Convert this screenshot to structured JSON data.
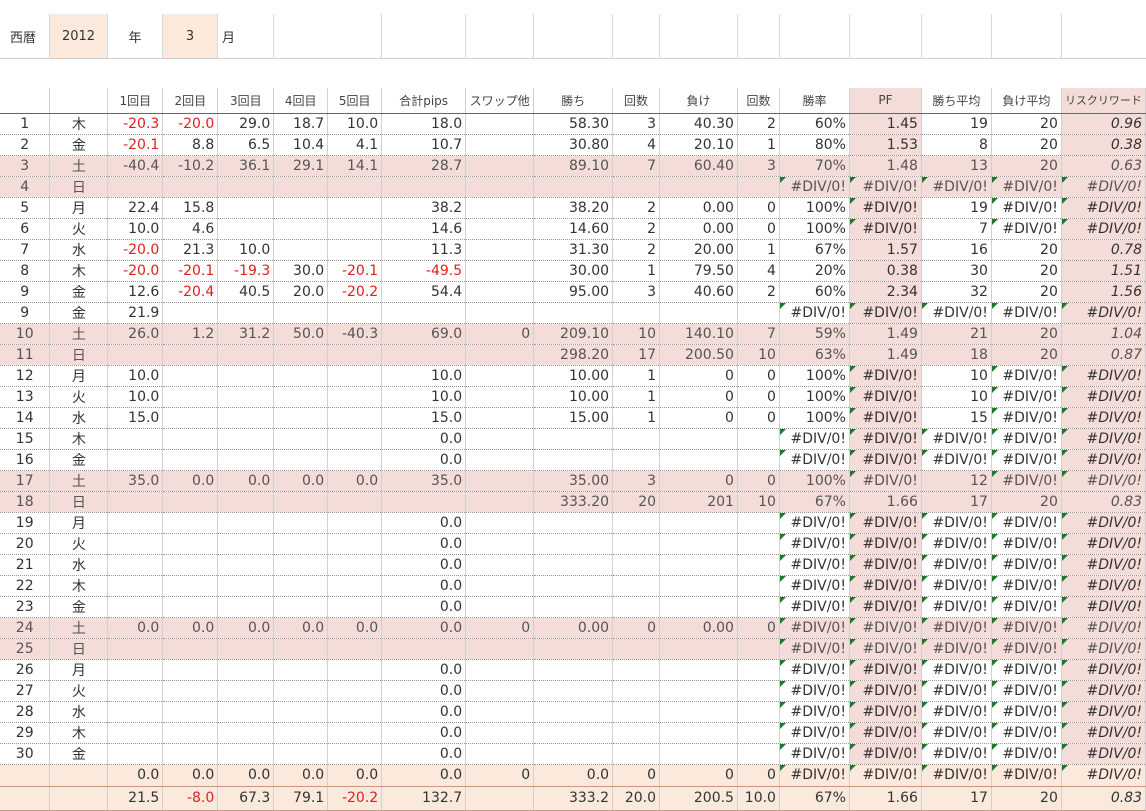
{
  "header": {
    "era_label": "西暦",
    "year": "2012",
    "year_unit": "年",
    "month": "3",
    "month_unit": "月"
  },
  "columns": [
    "",
    "",
    "1回目",
    "2回目",
    "3回目",
    "4回目",
    "5回目",
    "合計pips",
    "スワップ他",
    "勝ち",
    "回数",
    "負け",
    "回数",
    "勝率",
    "PF",
    "勝ち平均",
    "負け平均",
    "リスクリワード"
  ],
  "rows": [
    {
      "d": "1",
      "w": "木",
      "t": [
        "-20.3",
        "-20.0",
        "29.0",
        "18.7",
        "10.0"
      ],
      "sum": "18.0",
      "swap": "",
      "win": "58.30",
      "wn": "3",
      "loss": "40.30",
      "ln": "2",
      "rate": "60%",
      "pf": "1.45",
      "wa": "19",
      "la": "20",
      "rr": "0.96"
    },
    {
      "d": "2",
      "w": "金",
      "t": [
        "-20.1",
        "8.8",
        "6.5",
        "10.4",
        "4.1"
      ],
      "sum": "10.7",
      "swap": "",
      "win": "30.80",
      "wn": "4",
      "loss": "20.10",
      "ln": "1",
      "rate": "80%",
      "pf": "1.53",
      "wa": "8",
      "la": "20",
      "rr": "0.38"
    },
    {
      "d": "3",
      "w": "土",
      "t": [
        "-40.4",
        "-10.2",
        "36.1",
        "29.1",
        "14.1"
      ],
      "sum": "28.7",
      "swap": "",
      "win": "89.10",
      "wn": "7",
      "loss": "60.40",
      "ln": "3",
      "rate": "70%",
      "pf": "1.48",
      "wa": "13",
      "la": "20",
      "rr": "0.63",
      "weekend": true
    },
    {
      "d": "4",
      "w": "日",
      "t": [
        "",
        "",
        "",
        "",
        ""
      ],
      "sum": "",
      "swap": "",
      "win": "",
      "wn": "",
      "loss": "",
      "ln": "",
      "rate": "#DIV/0!",
      "pf": "#DIV/0!",
      "wa": "#DIV/0!",
      "la": "#DIV/0!",
      "rr": "#DIV/0!",
      "weekend": true
    },
    {
      "d": "5",
      "w": "月",
      "t": [
        "22.4",
        "15.8",
        "",
        "",
        ""
      ],
      "sum": "38.2",
      "swap": "",
      "win": "38.20",
      "wn": "2",
      "loss": "0.00",
      "ln": "0",
      "rate": "100%",
      "pf": "#DIV/0!",
      "wa": "19",
      "la": "#DIV/0!",
      "rr": "#DIV/0!"
    },
    {
      "d": "6",
      "w": "火",
      "t": [
        "10.0",
        "4.6",
        "",
        "",
        ""
      ],
      "sum": "14.6",
      "swap": "",
      "win": "14.60",
      "wn": "2",
      "loss": "0.00",
      "ln": "0",
      "rate": "100%",
      "pf": "#DIV/0!",
      "wa": "7",
      "la": "#DIV/0!",
      "rr": "#DIV/0!"
    },
    {
      "d": "7",
      "w": "水",
      "t": [
        "-20.0",
        "21.3",
        "10.0",
        "",
        ""
      ],
      "sum": "11.3",
      "swap": "",
      "win": "31.30",
      "wn": "2",
      "loss": "20.00",
      "ln": "1",
      "rate": "67%",
      "pf": "1.57",
      "wa": "16",
      "la": "20",
      "rr": "0.78"
    },
    {
      "d": "8",
      "w": "木",
      "t": [
        "-20.0",
        "-20.1",
        "-19.3",
        "30.0",
        "-20.1"
      ],
      "sum": "-49.5",
      "swap": "",
      "win": "30.00",
      "wn": "1",
      "loss": "79.50",
      "ln": "4",
      "rate": "20%",
      "pf": "0.38",
      "wa": "30",
      "la": "20",
      "rr": "1.51"
    },
    {
      "d": "9",
      "w": "金",
      "t": [
        "12.6",
        "-20.4",
        "40.5",
        "20.0",
        "-20.2"
      ],
      "sum": "54.4",
      "swap": "",
      "win": "95.00",
      "wn": "3",
      "loss": "40.60",
      "ln": "2",
      "rate": "60%",
      "pf": "2.34",
      "wa": "32",
      "la": "20",
      "rr": "1.56"
    },
    {
      "d": "9",
      "w": "金",
      "t": [
        "21.9",
        "",
        "",
        "",
        ""
      ],
      "sum": "",
      "swap": "",
      "win": "",
      "wn": "",
      "loss": "",
      "ln": "",
      "rate": "#DIV/0!",
      "pf": "#DIV/0!",
      "wa": "#DIV/0!",
      "la": "#DIV/0!",
      "rr": "#DIV/0!"
    },
    {
      "d": "10",
      "w": "土",
      "t": [
        "26.0",
        "1.2",
        "31.2",
        "50.0",
        "-40.3"
      ],
      "sum": "69.0",
      "swap": "0",
      "win": "209.10",
      "wn": "10",
      "loss": "140.10",
      "ln": "7",
      "rate": "59%",
      "pf": "1.49",
      "wa": "21",
      "la": "20",
      "rr": "1.04",
      "weekend": true
    },
    {
      "d": "11",
      "w": "日",
      "t": [
        "",
        "",
        "",
        "",
        ""
      ],
      "sum": "",
      "swap": "",
      "win": "298.20",
      "wn": "17",
      "loss": "200.50",
      "ln": "10",
      "rate": "63%",
      "pf": "1.49",
      "wa": "18",
      "la": "20",
      "rr": "0.87",
      "weekend": true
    },
    {
      "d": "12",
      "w": "月",
      "t": [
        "10.0",
        "",
        "",
        "",
        ""
      ],
      "sum": "10.0",
      "swap": "",
      "win": "10.00",
      "wn": "1",
      "loss": "0",
      "ln": "0",
      "rate": "100%",
      "pf": "#DIV/0!",
      "wa": "10",
      "la": "#DIV/0!",
      "rr": "#DIV/0!"
    },
    {
      "d": "13",
      "w": "火",
      "t": [
        "10.0",
        "",
        "",
        "",
        ""
      ],
      "sum": "10.0",
      "swap": "",
      "win": "10.00",
      "wn": "1",
      "loss": "0",
      "ln": "0",
      "rate": "100%",
      "pf": "#DIV/0!",
      "wa": "10",
      "la": "#DIV/0!",
      "rr": "#DIV/0!"
    },
    {
      "d": "14",
      "w": "水",
      "t": [
        "15.0",
        "",
        "",
        "",
        ""
      ],
      "sum": "15.0",
      "swap": "",
      "win": "15.00",
      "wn": "1",
      "loss": "0",
      "ln": "0",
      "rate": "100%",
      "pf": "#DIV/0!",
      "wa": "15",
      "la": "#DIV/0!",
      "rr": "#DIV/0!"
    },
    {
      "d": "15",
      "w": "木",
      "t": [
        "",
        "",
        "",
        "",
        ""
      ],
      "sum": "0.0",
      "swap": "",
      "win": "",
      "wn": "",
      "loss": "",
      "ln": "",
      "rate": "#DIV/0!",
      "pf": "#DIV/0!",
      "wa": "#DIV/0!",
      "la": "#DIV/0!",
      "rr": "#DIV/0!"
    },
    {
      "d": "16",
      "w": "金",
      "t": [
        "",
        "",
        "",
        "",
        ""
      ],
      "sum": "0.0",
      "swap": "",
      "win": "",
      "wn": "",
      "loss": "",
      "ln": "",
      "rate": "#DIV/0!",
      "pf": "#DIV/0!",
      "wa": "#DIV/0!",
      "la": "#DIV/0!",
      "rr": "#DIV/0!"
    },
    {
      "d": "17",
      "w": "土",
      "t": [
        "35.0",
        "0.0",
        "0.0",
        "0.0",
        "0.0"
      ],
      "sum": "35.0",
      "swap": "",
      "win": "35.00",
      "wn": "3",
      "loss": "0",
      "ln": "0",
      "rate": "100%",
      "pf": "#DIV/0!",
      "wa": "12",
      "la": "#DIV/0!",
      "rr": "#DIV/0!",
      "weekend": true
    },
    {
      "d": "18",
      "w": "日",
      "t": [
        "",
        "",
        "",
        "",
        ""
      ],
      "sum": "",
      "swap": "",
      "win": "333.20",
      "wn": "20",
      "loss": "201",
      "ln": "10",
      "rate": "67%",
      "pf": "1.66",
      "wa": "17",
      "la": "20",
      "rr": "0.83",
      "weekend": true
    },
    {
      "d": "19",
      "w": "月",
      "t": [
        "",
        "",
        "",
        "",
        ""
      ],
      "sum": "0.0",
      "swap": "",
      "win": "",
      "wn": "",
      "loss": "",
      "ln": "",
      "rate": "#DIV/0!",
      "pf": "#DIV/0!",
      "wa": "#DIV/0!",
      "la": "#DIV/0!",
      "rr": "#DIV/0!"
    },
    {
      "d": "20",
      "w": "火",
      "t": [
        "",
        "",
        "",
        "",
        ""
      ],
      "sum": "0.0",
      "swap": "",
      "win": "",
      "wn": "",
      "loss": "",
      "ln": "",
      "rate": "#DIV/0!",
      "pf": "#DIV/0!",
      "wa": "#DIV/0!",
      "la": "#DIV/0!",
      "rr": "#DIV/0!",
      "tall": true
    },
    {
      "d": "21",
      "w": "水",
      "t": [
        "",
        "",
        "",
        "",
        ""
      ],
      "sum": "0.0",
      "swap": "",
      "win": "",
      "wn": "",
      "loss": "",
      "ln": "",
      "rate": "#DIV/0!",
      "pf": "#DIV/0!",
      "wa": "#DIV/0!",
      "la": "#DIV/0!",
      "rr": "#DIV/0!",
      "tall": true
    },
    {
      "d": "22",
      "w": "木",
      "t": [
        "",
        "",
        "",
        "",
        ""
      ],
      "sum": "0.0",
      "swap": "",
      "win": "",
      "wn": "",
      "loss": "",
      "ln": "",
      "rate": "#DIV/0!",
      "pf": "#DIV/0!",
      "wa": "#DIV/0!",
      "la": "#DIV/0!",
      "rr": "#DIV/0!"
    },
    {
      "d": "23",
      "w": "金",
      "t": [
        "",
        "",
        "",
        "",
        ""
      ],
      "sum": "0.0",
      "swap": "",
      "win": "",
      "wn": "",
      "loss": "",
      "ln": "",
      "rate": "#DIV/0!",
      "pf": "#DIV/0!",
      "wa": "#DIV/0!",
      "la": "#DIV/0!",
      "rr": "#DIV/0!"
    },
    {
      "d": "24",
      "w": "土",
      "t": [
        "0.0",
        "0.0",
        "0.0",
        "0.0",
        "0.0"
      ],
      "sum": "0.0",
      "swap": "0",
      "win": "0.00",
      "wn": "0",
      "loss": "0.00",
      "ln": "0",
      "rate": "#DIV/0!",
      "pf": "#DIV/0!",
      "wa": "#DIV/0!",
      "la": "#DIV/0!",
      "rr": "#DIV/0!",
      "weekend": true
    },
    {
      "d": "25",
      "w": "日",
      "t": [
        "",
        "",
        "",
        "",
        ""
      ],
      "sum": "",
      "swap": "",
      "win": "",
      "wn": "",
      "loss": "",
      "ln": "",
      "rate": "#DIV/0!",
      "pf": "#DIV/0!",
      "wa": "#DIV/0!",
      "la": "#DIV/0!",
      "rr": "#DIV/0!",
      "weekend": true
    },
    {
      "d": "26",
      "w": "月",
      "t": [
        "",
        "",
        "",
        "",
        ""
      ],
      "sum": "0.0",
      "swap": "",
      "win": "",
      "wn": "",
      "loss": "",
      "ln": "",
      "rate": "#DIV/0!",
      "pf": "#DIV/0!",
      "wa": "#DIV/0!",
      "la": "#DIV/0!",
      "rr": "#DIV/0!"
    },
    {
      "d": "27",
      "w": "火",
      "t": [
        "",
        "",
        "",
        "",
        ""
      ],
      "sum": "0.0",
      "swap": "",
      "win": "",
      "wn": "",
      "loss": "",
      "ln": "",
      "rate": "#DIV/0!",
      "pf": "#DIV/0!",
      "wa": "#DIV/0!",
      "la": "#DIV/0!",
      "rr": "#DIV/0!"
    },
    {
      "d": "28",
      "w": "水",
      "t": [
        "",
        "",
        "",
        "",
        ""
      ],
      "sum": "0.0",
      "swap": "",
      "win": "",
      "wn": "",
      "loss": "",
      "ln": "",
      "rate": "#DIV/0!",
      "pf": "#DIV/0!",
      "wa": "#DIV/0!",
      "la": "#DIV/0!",
      "rr": "#DIV/0!"
    },
    {
      "d": "29",
      "w": "木",
      "t": [
        "",
        "",
        "",
        "",
        ""
      ],
      "sum": "0.0",
      "swap": "",
      "win": "",
      "wn": "",
      "loss": "",
      "ln": "",
      "rate": "#DIV/0!",
      "pf": "#DIV/0!",
      "wa": "#DIV/0!",
      "la": "#DIV/0!",
      "rr": "#DIV/0!"
    },
    {
      "d": "30",
      "w": "金",
      "t": [
        "",
        "",
        "",
        "",
        ""
      ],
      "sum": "0.0",
      "swap": "",
      "win": "",
      "wn": "",
      "loss": "",
      "ln": "",
      "rate": "#DIV/0!",
      "pf": "#DIV/0!",
      "wa": "#DIV/0!",
      "la": "#DIV/0!",
      "rr": "#DIV/0!"
    }
  ],
  "total_row": {
    "t": [
      "0.0",
      "0.0",
      "0.0",
      "0.0",
      "0.0"
    ],
    "sum": "0.0",
    "swap": "0",
    "win": "0.0",
    "wn": "0",
    "loss": "0",
    "ln": "0",
    "rate": "#DIV/0!",
    "pf": "#DIV/0!",
    "wa": "#DIV/0!",
    "la": "#DIV/0!",
    "rr": "#DIV/0!"
  },
  "grand_row": {
    "t": [
      "21.5",
      "-8.0",
      "67.3",
      "79.1",
      "-20.2"
    ],
    "sum": "132.7",
    "swap": "",
    "win": "333.2",
    "wn": "20.0",
    "loss": "200.5",
    "ln": "10.0",
    "rate": "67%",
    "pf": "1.66",
    "wa": "17",
    "la": "20",
    "rr": "0.83"
  },
  "colors": {
    "negative": "#e0201e",
    "weekend_fill": "#f4dcd9",
    "total_fill": "#fbe9dc",
    "error_marker": "#1a7a2a"
  }
}
